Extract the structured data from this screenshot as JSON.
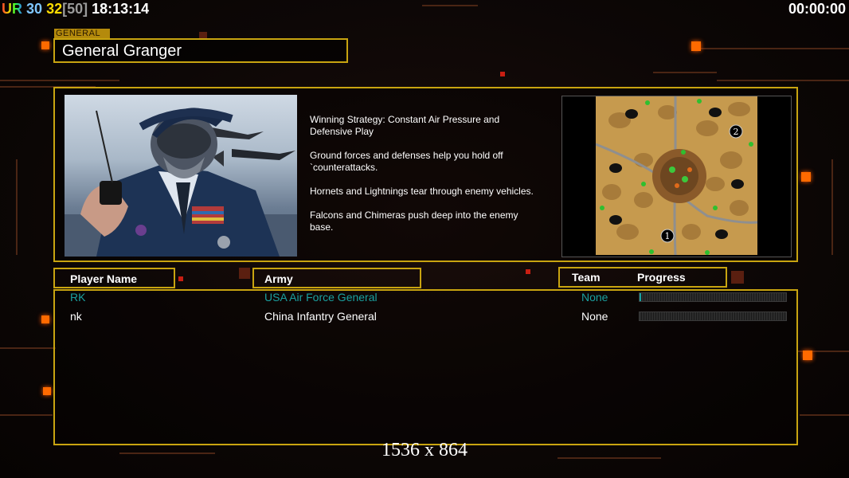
{
  "hud": {
    "ur_label": "UR",
    "n1": "30",
    "n2": "32",
    "n3": "[50]",
    "clock": "18:13:14",
    "timer": "00:00:00"
  },
  "general": {
    "tag": "GENERAL",
    "name": "General Granger"
  },
  "strategy": {
    "lines": [
      "Winning Strategy: Constant Air Pressure and\n Defensive Play",
      "Ground forces and defenses help you hold off\n`counterattacks.",
      "Hornets and Lightnings tear through enemy vehicles.",
      "Falcons and Chimeras push deep into the enemy\n base."
    ]
  },
  "map": {
    "start_labels": [
      "1",
      "2"
    ]
  },
  "headers": {
    "player_name": "Player Name",
    "army": "Army",
    "team": "Team",
    "progress": "Progress"
  },
  "players": [
    {
      "name": "RK",
      "army": "USA Air Force General",
      "team": "None",
      "progress": 0.01,
      "color": "#1aa0a0"
    },
    {
      "name": "nk",
      "army": "China Infantry General",
      "team": "None",
      "progress": 0,
      "color": "#ffffff"
    }
  ],
  "resolution": "1536 x 864",
  "colors": {
    "frame": "#c8a410",
    "accent": "#ff6a00"
  }
}
